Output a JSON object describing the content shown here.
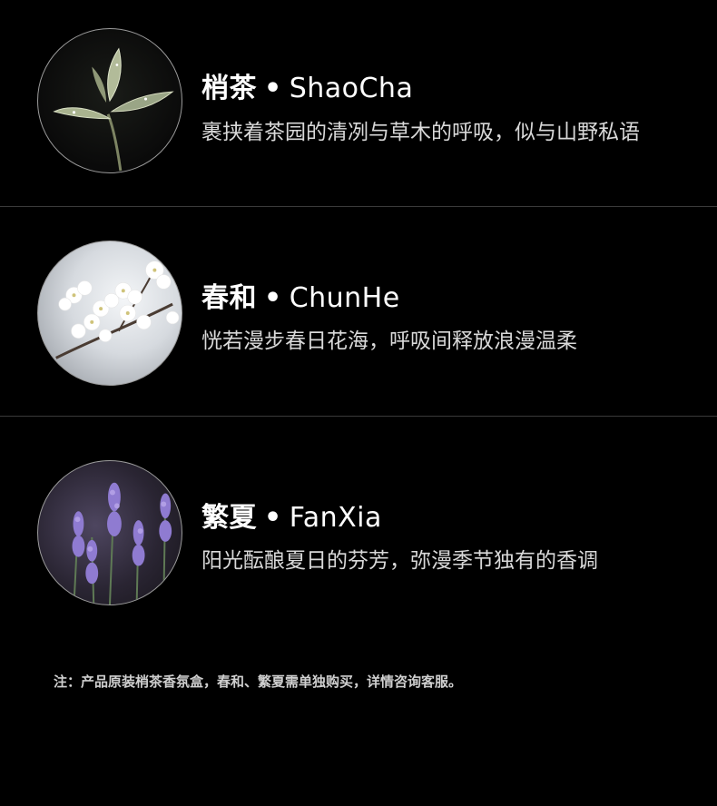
{
  "items": [
    {
      "name_cn": "梢茶",
      "separator": "•",
      "name_en": "ShaoCha",
      "description": "裹挟着茶园的清冽与草木的呼吸，似与山野私语",
      "image_alt": "tea-leaf-icon"
    },
    {
      "name_cn": "春和",
      "separator": "•",
      "name_en": "ChunHe",
      "description": "恍若漫步春日花海，呼吸间释放浪漫温柔",
      "image_alt": "blossom-icon"
    },
    {
      "name_cn": "繁夏",
      "separator": "•",
      "name_en": "FanXia",
      "description": "阳光酝酿夏日的芬芳，弥漫季节独有的香调",
      "image_alt": "lavender-icon"
    }
  ],
  "note": "注：产品原装梢茶香氛盒，春和、繁夏需单独购买，详情咨询客服。"
}
